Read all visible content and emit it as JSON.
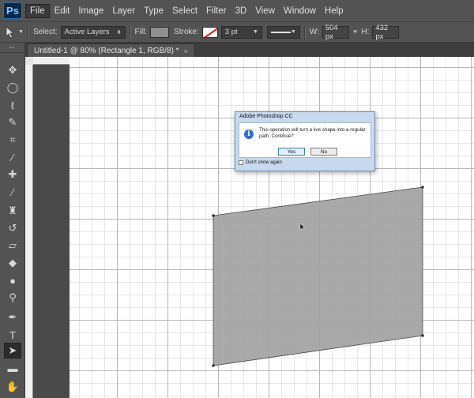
{
  "app": {
    "logo": "Ps"
  },
  "menu": [
    "File",
    "Edit",
    "Image",
    "Layer",
    "Type",
    "Select",
    "Filter",
    "3D",
    "View",
    "Window",
    "Help"
  ],
  "options_bar": {
    "select_label": "Select:",
    "select_value": "Active Layers",
    "fill_label": "Fill:",
    "fill_color": "#8f8f8f",
    "stroke_label": "Stroke:",
    "stroke_width": "3 pt",
    "w_label": "W:",
    "w_value": "504 px",
    "h_label": "H:",
    "h_value": "432 px"
  },
  "document_tab": {
    "title": "Untitled-1 @ 80% (Rectangle 1, RGB/8) *",
    "close": "×"
  },
  "tools": [
    {
      "name": "move-tool",
      "glyph": "✥"
    },
    {
      "name": "ellipse-marquee-tool",
      "glyph": "◯"
    },
    {
      "name": "lasso-tool",
      "glyph": "ℓ"
    },
    {
      "name": "quick-selection-tool",
      "glyph": "✎"
    },
    {
      "name": "crop-tool",
      "glyph": "⌗"
    },
    {
      "name": "eyedropper-tool",
      "glyph": "⁄"
    },
    {
      "name": "healing-brush-tool",
      "glyph": "✚"
    },
    {
      "name": "brush-tool",
      "glyph": "∕"
    },
    {
      "name": "clone-stamp-tool",
      "glyph": "♜"
    },
    {
      "name": "history-brush-tool",
      "glyph": "↺"
    },
    {
      "name": "eraser-tool",
      "glyph": "▱"
    },
    {
      "name": "paint-bucket-tool",
      "glyph": "◆"
    },
    {
      "name": "blur-tool",
      "glyph": "●"
    },
    {
      "name": "dodge-tool",
      "glyph": "⚲"
    },
    {
      "name": "pen-tool",
      "glyph": "✒"
    },
    {
      "name": "type-tool",
      "glyph": "T"
    },
    {
      "name": "direct-selection-tool",
      "glyph": "➤"
    },
    {
      "name": "rectangle-tool",
      "glyph": "▬"
    },
    {
      "name": "hand-tool",
      "glyph": "✋"
    }
  ],
  "dialog": {
    "title": "Adobe Photoshop CC",
    "message": "This operation will turn a live shape into a regular path. Continue?",
    "yes": "Yes",
    "no": "No",
    "dont_show": "Don't show again"
  },
  "shape": {
    "fill_color": "#a2a2a2"
  }
}
